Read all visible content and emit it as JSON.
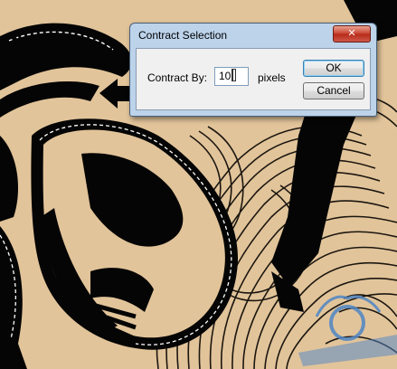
{
  "dialog": {
    "title": "Contract Selection",
    "close_glyph": "✕",
    "contract_label": "Contract By:",
    "contract_value": "10",
    "units": "pixels",
    "ok_label": "OK",
    "cancel_label": "Cancel"
  },
  "background": {
    "description_icon": "artwork-canvas",
    "paper_color": "#e2c49a"
  }
}
